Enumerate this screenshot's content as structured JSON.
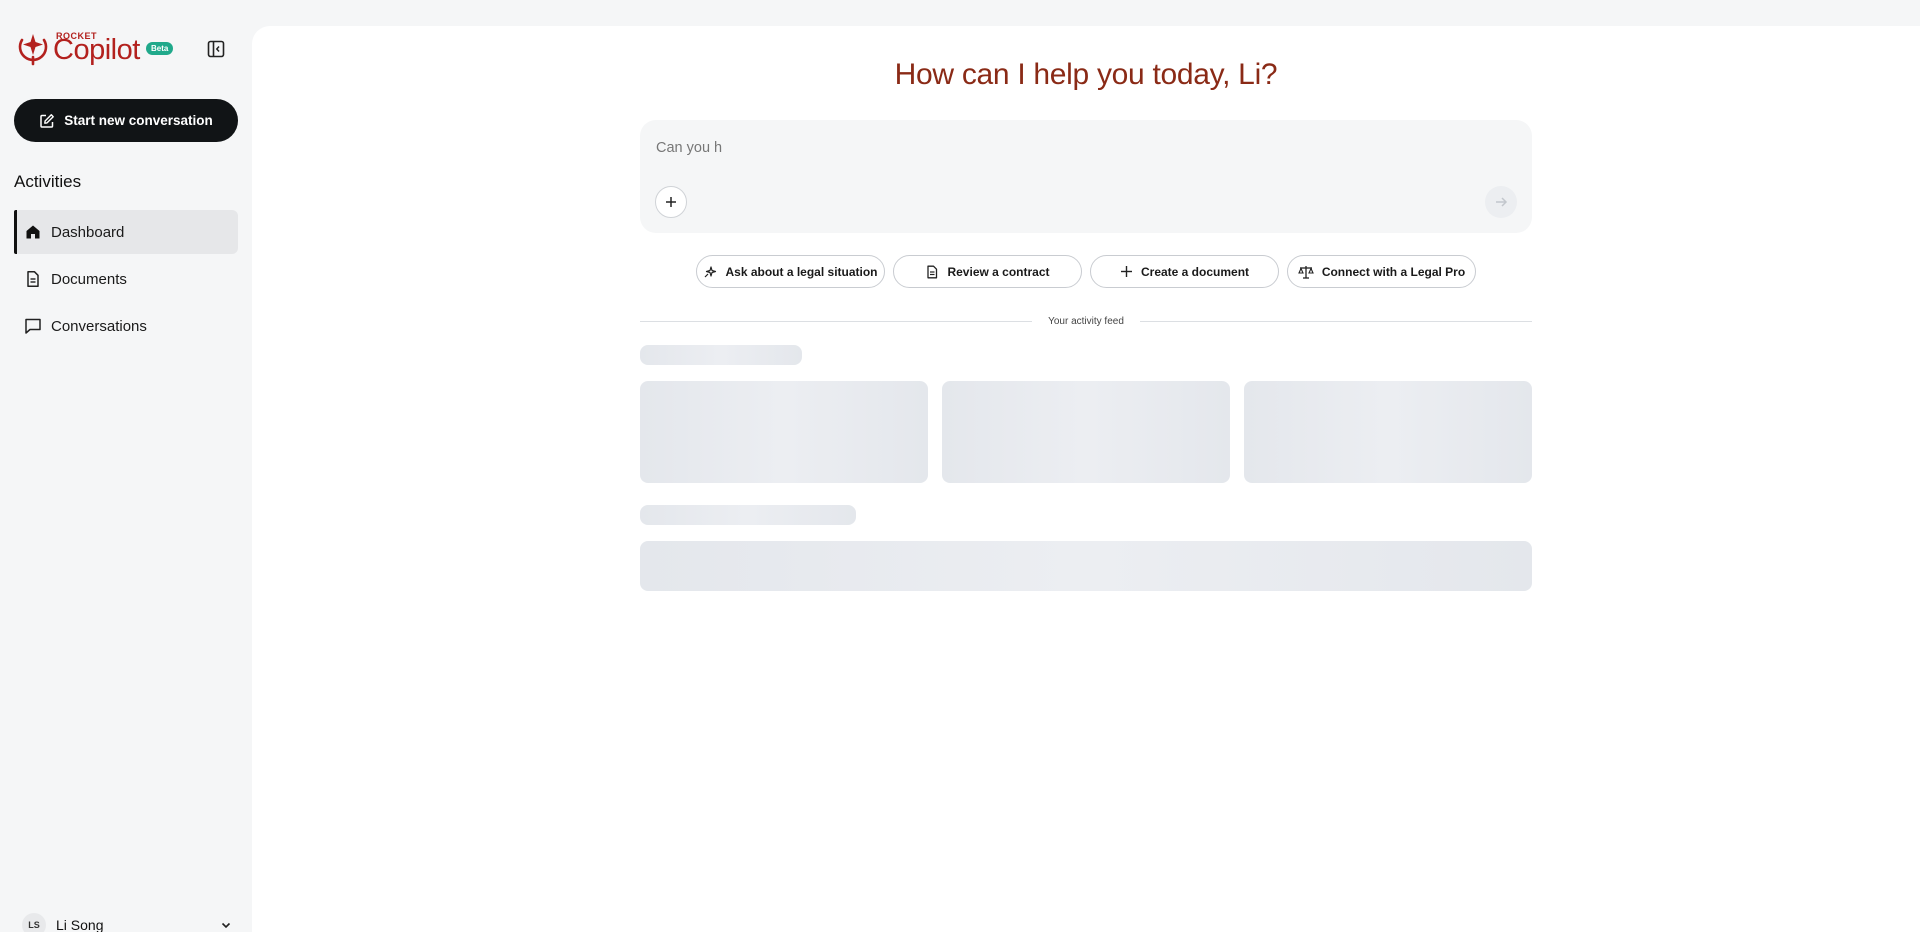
{
  "brand": {
    "small_label": "ROCKET",
    "name": "Copilot",
    "badge": "Beta",
    "color": "#b3211e",
    "badge_color": "#20a98b"
  },
  "sidebar": {
    "new_conversation_label": "Start new conversation",
    "section_title": "Activities",
    "items": [
      {
        "label": "Dashboard",
        "icon": "home-icon",
        "active": true
      },
      {
        "label": "Documents",
        "icon": "document-icon",
        "active": false
      },
      {
        "label": "Conversations",
        "icon": "chat-icon",
        "active": false
      }
    ],
    "user": {
      "initials": "LS",
      "name": "Li Song"
    }
  },
  "main": {
    "greeting": "How can I help you today, Li?",
    "composer": {
      "value": "Can you h"
    },
    "suggestions": [
      {
        "label": "Ask about a legal situation",
        "icon": "sparkle-icon"
      },
      {
        "label": "Review a contract",
        "icon": "document-icon"
      },
      {
        "label": "Create a document",
        "icon": "plus-icon"
      },
      {
        "label": "Connect with a Legal Pro",
        "icon": "scales-icon"
      }
    ],
    "feed_label": "Your activity feed"
  },
  "colors": {
    "greeting": "#8a2a16",
    "primary_button": "#111416"
  }
}
